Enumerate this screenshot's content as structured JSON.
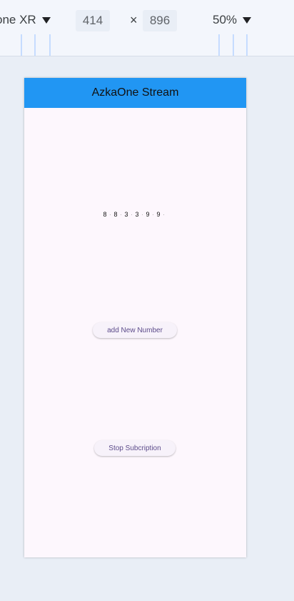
{
  "devtools": {
    "device": "one XR",
    "width": "414",
    "times": "×",
    "height": "896",
    "zoom": "50%"
  },
  "app": {
    "title": "AzkaOne Stream",
    "numbers": [
      "8",
      "8",
      "3",
      "3",
      "9",
      "9"
    ],
    "add_button": "add New Number",
    "stop_button": "Stop Subcription"
  },
  "colors": {
    "appbar": "#2196f3",
    "screen_bg": "#fdf7fd",
    "button_text": "#5c4b8a"
  }
}
